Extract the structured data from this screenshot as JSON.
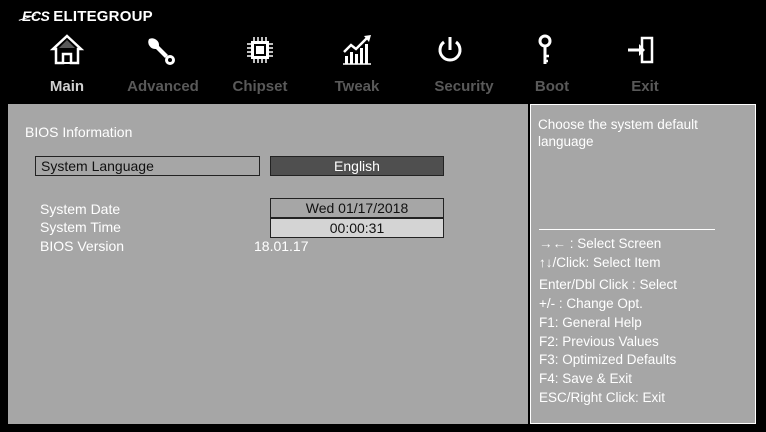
{
  "brand": {
    "logo": "ECS",
    "name": "ELITEGROUP"
  },
  "tabs": [
    {
      "label": "Main",
      "icon": "home-icon",
      "active": true
    },
    {
      "label": "Advanced",
      "icon": "wrench-icon",
      "active": false
    },
    {
      "label": "Chipset",
      "icon": "chip-icon",
      "active": false
    },
    {
      "label": "Tweak",
      "icon": "performance-graph-icon",
      "active": false
    },
    {
      "label": "Security",
      "icon": "power-icon",
      "active": false
    },
    {
      "label": "Boot",
      "icon": "key-icon",
      "active": false
    },
    {
      "label": "Exit",
      "icon": "exit-icon",
      "active": false
    }
  ],
  "main": {
    "section_title": "BIOS Information",
    "language": {
      "label": "System Language",
      "value": "English"
    },
    "date": {
      "label": "System Date",
      "value": "Wed 01/17/2018"
    },
    "time": {
      "label": "System Time",
      "value": "00:00:31"
    },
    "bios_version": {
      "label": "BIOS Version",
      "value": "18.01.17"
    }
  },
  "help": {
    "description": "Choose the system default language",
    "keys": [
      "→←  : Select Screen",
      "↑↓/Click: Select Item",
      "Enter/Dbl Click : Select",
      "+/- : Change Opt.",
      "F1: General Help",
      "F2: Previous Values",
      "F3: Optimized Defaults",
      "F4: Save & Exit",
      "ESC/Right Click: Exit"
    ]
  },
  "colors": {
    "background": "#000000",
    "panel": "#a6a6a6",
    "active_tab": "#cfcfcf",
    "inactive_tab": "#595959",
    "selected_value": "#4f4f4f"
  }
}
